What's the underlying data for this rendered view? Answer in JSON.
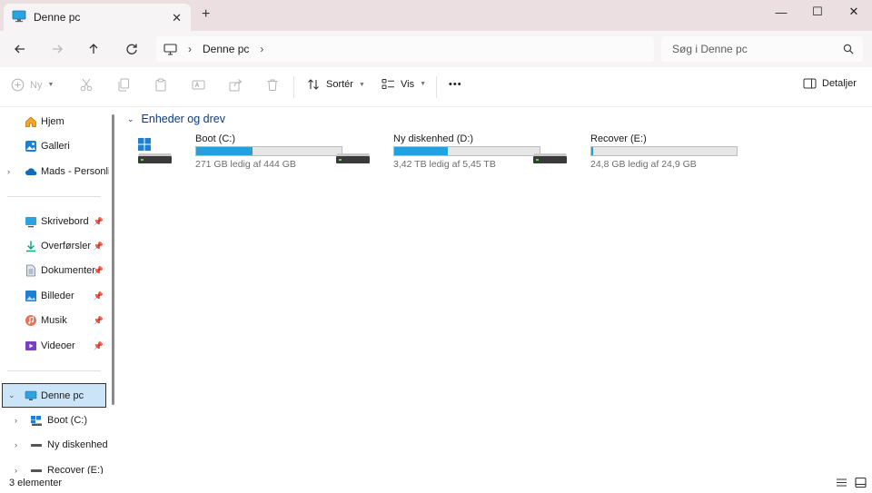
{
  "window": {
    "tab_title": "Denne pc",
    "tab_icon": "monitor-icon",
    "close_tab_glyph": "✕",
    "new_tab_glyph": "+",
    "controls": {
      "minimize": "—",
      "maximize": "☐",
      "close": "✕"
    }
  },
  "address": {
    "crumbs": [
      "Denne pc"
    ],
    "search_placeholder": "Søg i Denne pc"
  },
  "toolbar": {
    "new_label": "Ny",
    "sort_label": "Sortér",
    "view_label": "Vis",
    "more_label": "•••",
    "details_label": "Detaljer"
  },
  "nav": {
    "quick": [
      {
        "label": "Hjem",
        "icon": "home-icon"
      },
      {
        "label": "Galleri",
        "icon": "gallery-icon"
      },
      {
        "label": "Mads - Personlig",
        "icon": "onedrive-cloud-icon"
      }
    ],
    "pinned": [
      {
        "label": "Skrivebord",
        "icon": "desktop-icon"
      },
      {
        "label": "Overførsler",
        "icon": "download-icon"
      },
      {
        "label": "Dokumenter",
        "icon": "documents-icon"
      },
      {
        "label": "Billeder",
        "icon": "pictures-icon"
      },
      {
        "label": "Musik",
        "icon": "music-icon"
      },
      {
        "label": "Videoer",
        "icon": "videos-icon"
      }
    ],
    "this_pc": "Denne pc",
    "drives": [
      "Boot (C:)",
      "Ny diskenhed",
      "Recover (E:)"
    ]
  },
  "content": {
    "group_title": "Enheder og drev",
    "drives": [
      {
        "name": "Boot (C:)",
        "free_text": "271 GB ledig af 444 GB",
        "used_fraction": 0.39,
        "icon": "windows-drive-icon"
      },
      {
        "name": "Ny diskenhed (D:)",
        "free_text": "3,42 TB ledig af 5,45 TB",
        "used_fraction": 0.37,
        "icon": "hard-drive-icon"
      },
      {
        "name": "Recover (E:)",
        "free_text": "24,8 GB ledig af 24,9 GB",
        "used_fraction": 0.01,
        "icon": "hard-drive-icon"
      }
    ]
  },
  "status": {
    "items_text": "3 elementer"
  },
  "colors": {
    "accent": "#26a0da",
    "selection": "#cce4f7",
    "titlebar": "#ecdfe2"
  }
}
